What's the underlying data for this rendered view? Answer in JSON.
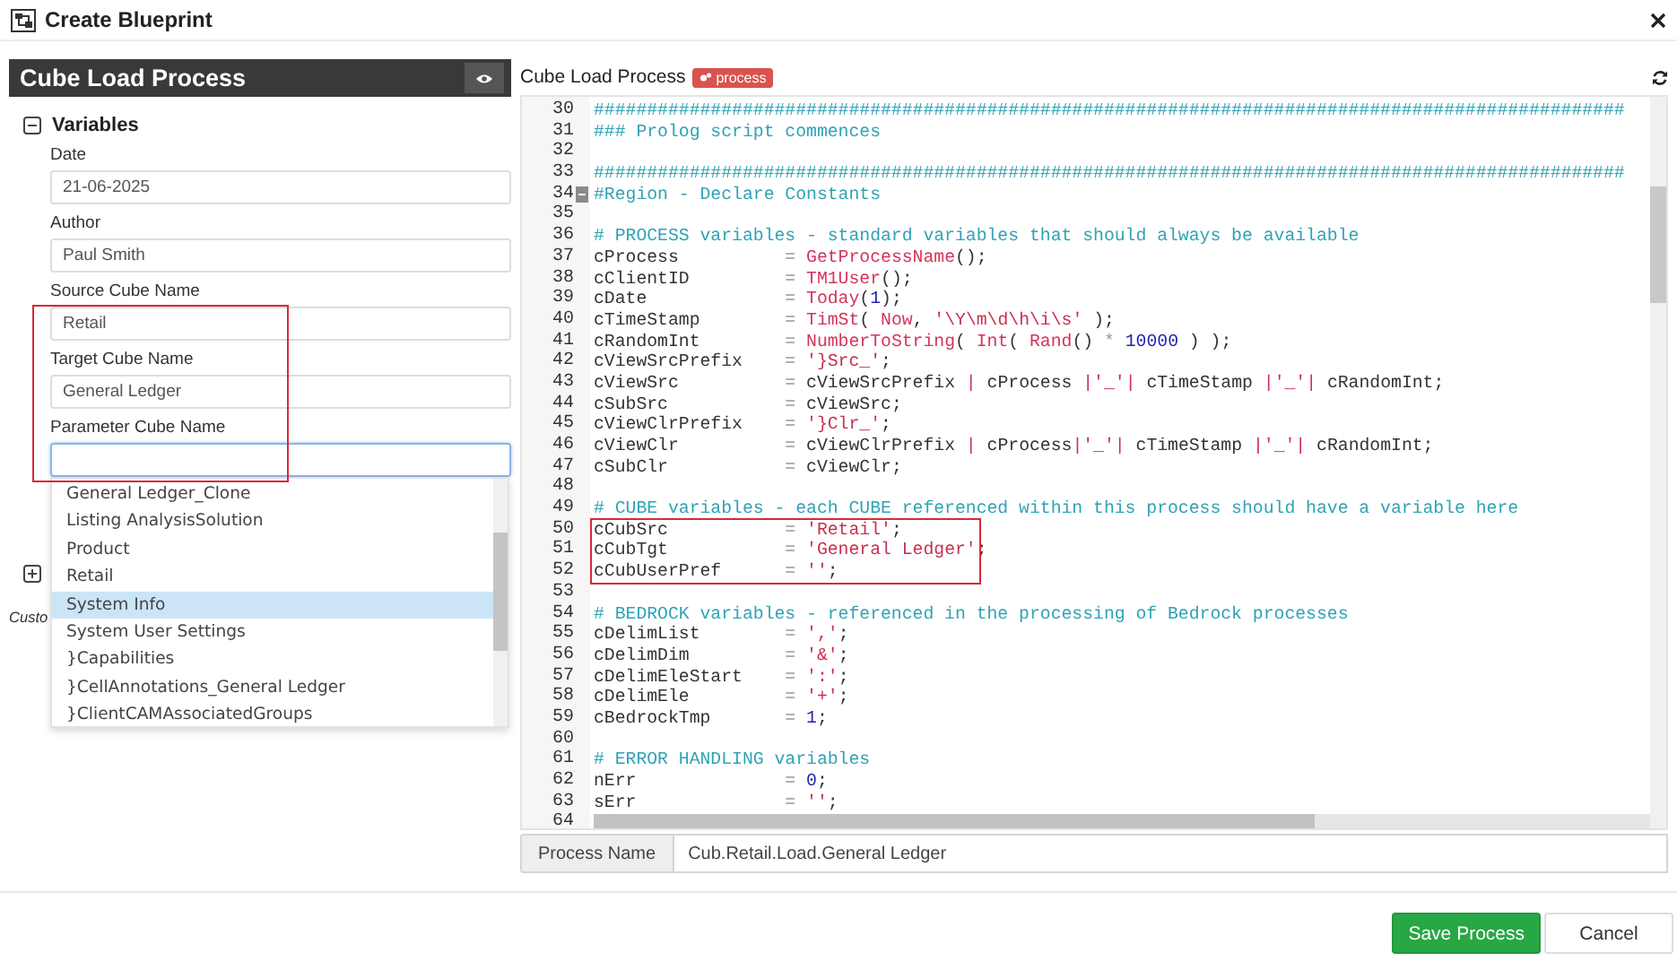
{
  "window": {
    "title": "Create Blueprint"
  },
  "left_panel": {
    "title": "Cube Load Process",
    "section": {
      "title": "Variables",
      "expanded": true
    },
    "fields": [
      {
        "label": "Date",
        "value": "21-06-2025",
        "highlighted": false,
        "focused": false
      },
      {
        "label": "Author",
        "value": "Paul Smith",
        "highlighted": false,
        "focused": false
      },
      {
        "label": "Source Cube Name",
        "value": "Retail",
        "highlighted": true,
        "focused": false
      },
      {
        "label": "Target Cube Name",
        "value": "General Ledger",
        "highlighted": true,
        "focused": false
      },
      {
        "label": "Parameter Cube Name",
        "highlighted": true,
        "focused": true
      }
    ],
    "second_section": {
      "expanded": false
    },
    "custom_label": "Custo"
  },
  "dropdown": {
    "items": [
      {
        "label": "General Ledger_Clone",
        "selected": false
      },
      {
        "label": "Listing AnalysisSolution",
        "selected": false
      },
      {
        "label": "Product",
        "selected": false
      },
      {
        "label": "Retail",
        "selected": false
      },
      {
        "label": "System Info",
        "selected": true
      },
      {
        "label": "System User Settings",
        "selected": false
      },
      {
        "label": "}Capabilities",
        "selected": false
      },
      {
        "label": "}CellAnnotations_General Ledger",
        "selected": false
      },
      {
        "label": "}ClientCAMAssociatedGroups",
        "selected": false
      }
    ]
  },
  "editor": {
    "title": "Cube Load Process",
    "badge": "process",
    "lines": [
      {
        "number": "30",
        "tokens": [
          {
            "kind": "comment",
            "text": "#################################################################################################"
          }
        ]
      },
      {
        "number": "31",
        "tokens": [
          {
            "kind": "comment",
            "text": "### Prolog script commences"
          }
        ]
      },
      {
        "number": "32"
      },
      {
        "number": "33",
        "tokens": [
          {
            "kind": "comment",
            "text": "#################################################################################################"
          }
        ]
      },
      {
        "number": "34",
        "foldable": true,
        "tokens": [
          {
            "kind": "comment",
            "text": "#Region - Declare Constants"
          }
        ]
      },
      {
        "number": "35"
      },
      {
        "number": "36",
        "tokens": [
          {
            "kind": "comment",
            "text": "# PROCESS variables - standard variables that should always be available"
          }
        ]
      },
      {
        "number": "37",
        "tokens": [
          {
            "kind": "var",
            "text": "cProcess          "
          },
          {
            "kind": "op",
            "text": "= "
          },
          {
            "kind": "func",
            "text": "GetProcessName"
          },
          {
            "kind": "var",
            "text": "();"
          }
        ]
      },
      {
        "number": "38",
        "tokens": [
          {
            "kind": "var",
            "text": "cClientID         "
          },
          {
            "kind": "op",
            "text": "= "
          },
          {
            "kind": "func",
            "text": "TM1User"
          },
          {
            "kind": "var",
            "text": "();"
          }
        ]
      },
      {
        "number": "39",
        "tokens": [
          {
            "kind": "var",
            "text": "cDate             "
          },
          {
            "kind": "op",
            "text": "= "
          },
          {
            "kind": "func",
            "text": "Today"
          },
          {
            "kind": "var",
            "text": "("
          },
          {
            "kind": "num",
            "text": "1"
          },
          {
            "kind": "var",
            "text": ");"
          }
        ]
      },
      {
        "number": "40",
        "tokens": [
          {
            "kind": "var",
            "text": "cTimeStamp        "
          },
          {
            "kind": "op",
            "text": "= "
          },
          {
            "kind": "func",
            "text": "TimSt"
          },
          {
            "kind": "var",
            "text": "( "
          },
          {
            "kind": "func",
            "text": "Now"
          },
          {
            "kind": "var",
            "text": ", "
          },
          {
            "kind": "str",
            "text": "'\\Y\\m\\d\\h\\i\\s'"
          },
          {
            "kind": "var",
            "text": " );"
          }
        ]
      },
      {
        "number": "41",
        "tokens": [
          {
            "kind": "var",
            "text": "cRandomInt        "
          },
          {
            "kind": "op",
            "text": "= "
          },
          {
            "kind": "func",
            "text": "NumberToString"
          },
          {
            "kind": "var",
            "text": "( "
          },
          {
            "kind": "func",
            "text": "Int"
          },
          {
            "kind": "var",
            "text": "( "
          },
          {
            "kind": "func",
            "text": "Rand"
          },
          {
            "kind": "var",
            "text": "() "
          },
          {
            "kind": "op",
            "text": "* "
          },
          {
            "kind": "num",
            "text": "10000"
          },
          {
            "kind": "var",
            "text": " ) );"
          }
        ]
      },
      {
        "number": "42",
        "tokens": [
          {
            "kind": "var",
            "text": "cViewSrcPrefix    "
          },
          {
            "kind": "op",
            "text": "= "
          },
          {
            "kind": "str",
            "text": "'}Src_'"
          },
          {
            "kind": "var",
            "text": ";"
          }
        ]
      },
      {
        "number": "43",
        "tokens": [
          {
            "kind": "var",
            "text": "cViewSrc          "
          },
          {
            "kind": "op",
            "text": "= "
          },
          {
            "kind": "var",
            "text": "cViewSrcPrefix "
          },
          {
            "kind": "str",
            "text": "|"
          },
          {
            "kind": "var",
            "text": " cProcess "
          },
          {
            "kind": "str",
            "text": "|'_'|"
          },
          {
            "kind": "var",
            "text": " cTimeStamp "
          },
          {
            "kind": "str",
            "text": "|'_'|"
          },
          {
            "kind": "var",
            "text": " cRandomInt;"
          }
        ]
      },
      {
        "number": "44",
        "tokens": [
          {
            "kind": "var",
            "text": "cSubSrc           "
          },
          {
            "kind": "op",
            "text": "= "
          },
          {
            "kind": "var",
            "text": "cViewSrc;"
          }
        ]
      },
      {
        "number": "45",
        "tokens": [
          {
            "kind": "var",
            "text": "cViewClrPrefix    "
          },
          {
            "kind": "op",
            "text": "= "
          },
          {
            "kind": "str",
            "text": "'}Clr_'"
          },
          {
            "kind": "var",
            "text": ";"
          }
        ]
      },
      {
        "number": "46",
        "tokens": [
          {
            "kind": "var",
            "text": "cViewClr          "
          },
          {
            "kind": "op",
            "text": "= "
          },
          {
            "kind": "var",
            "text": "cViewClrPrefix "
          },
          {
            "kind": "str",
            "text": "|"
          },
          {
            "kind": "var",
            "text": " cProcess"
          },
          {
            "kind": "str",
            "text": "|'_'|"
          },
          {
            "kind": "var",
            "text": " cTimeStamp "
          },
          {
            "kind": "str",
            "text": "|'_'|"
          },
          {
            "kind": "var",
            "text": " cRandomInt;"
          }
        ]
      },
      {
        "number": "47",
        "tokens": [
          {
            "kind": "var",
            "text": "cSubClr           "
          },
          {
            "kind": "op",
            "text": "= "
          },
          {
            "kind": "var",
            "text": "cViewClr;"
          }
        ]
      },
      {
        "number": "48"
      },
      {
        "number": "49",
        "tokens": [
          {
            "kind": "comment",
            "text": "# CUBE variables - each CUBE referenced within this process should have a variable here"
          }
        ]
      },
      {
        "number": "50",
        "highlighted": true,
        "tokens": [
          {
            "kind": "var",
            "text": "cCubSrc           "
          },
          {
            "kind": "op",
            "text": "= "
          },
          {
            "kind": "str",
            "text": "'Retail'"
          },
          {
            "kind": "var",
            "text": ";"
          }
        ]
      },
      {
        "number": "51",
        "highlighted": true,
        "tokens": [
          {
            "kind": "var",
            "text": "cCubTgt           "
          },
          {
            "kind": "op",
            "text": "= "
          },
          {
            "kind": "str",
            "text": "'General Ledger'"
          },
          {
            "kind": "var",
            "text": ";"
          }
        ]
      },
      {
        "number": "52",
        "highlighted": true,
        "tokens": [
          {
            "kind": "var",
            "text": "cCubUserPref      "
          },
          {
            "kind": "op",
            "text": "= "
          },
          {
            "kind": "str",
            "text": "''"
          },
          {
            "kind": "var",
            "text": ";"
          }
        ]
      },
      {
        "number": "53"
      },
      {
        "number": "54",
        "tokens": [
          {
            "kind": "comment",
            "text": "# BEDROCK variables - referenced in the processing of Bedrock processes"
          }
        ]
      },
      {
        "number": "55",
        "tokens": [
          {
            "kind": "var",
            "text": "cDelimList        "
          },
          {
            "kind": "op",
            "text": "= "
          },
          {
            "kind": "str",
            "text": "','"
          },
          {
            "kind": "var",
            "text": ";"
          }
        ]
      },
      {
        "number": "56",
        "tokens": [
          {
            "kind": "var",
            "text": "cDelimDim         "
          },
          {
            "kind": "op",
            "text": "= "
          },
          {
            "kind": "str",
            "text": "'&'"
          },
          {
            "kind": "var",
            "text": ";"
          }
        ]
      },
      {
        "number": "57",
        "tokens": [
          {
            "kind": "var",
            "text": "cDelimEleStart    "
          },
          {
            "kind": "op",
            "text": "= "
          },
          {
            "kind": "str",
            "text": "':'"
          },
          {
            "kind": "var",
            "text": ";"
          }
        ]
      },
      {
        "number": "58",
        "tokens": [
          {
            "kind": "var",
            "text": "cDelimEle         "
          },
          {
            "kind": "op",
            "text": "= "
          },
          {
            "kind": "str",
            "text": "'+'"
          },
          {
            "kind": "var",
            "text": ";"
          }
        ]
      },
      {
        "number": "59",
        "tokens": [
          {
            "kind": "var",
            "text": "cBedrockTmp       "
          },
          {
            "kind": "op",
            "text": "= "
          },
          {
            "kind": "num",
            "text": "1"
          },
          {
            "kind": "var",
            "text": ";"
          }
        ]
      },
      {
        "number": "60"
      },
      {
        "number": "61",
        "tokens": [
          {
            "kind": "comment",
            "text": "# ERROR HANDLING variables"
          }
        ]
      },
      {
        "number": "62",
        "tokens": [
          {
            "kind": "var",
            "text": "nErr              "
          },
          {
            "kind": "op",
            "text": "= "
          },
          {
            "kind": "num",
            "text": "0"
          },
          {
            "kind": "var",
            "text": ";"
          }
        ]
      },
      {
        "number": "63",
        "tokens": [
          {
            "kind": "var",
            "text": "sErr              "
          },
          {
            "kind": "op",
            "text": "= "
          },
          {
            "kind": "str",
            "text": "''"
          },
          {
            "kind": "var",
            "text": ";"
          }
        ]
      },
      {
        "number": "64"
      }
    ]
  },
  "process_name": {
    "label": "Process Name",
    "value": "Cub.Retail.Load.General Ledger"
  },
  "buttons": [
    {
      "label": "Save Process",
      "kind": "primary"
    },
    {
      "label": "Cancel",
      "kind": "default"
    }
  ]
}
